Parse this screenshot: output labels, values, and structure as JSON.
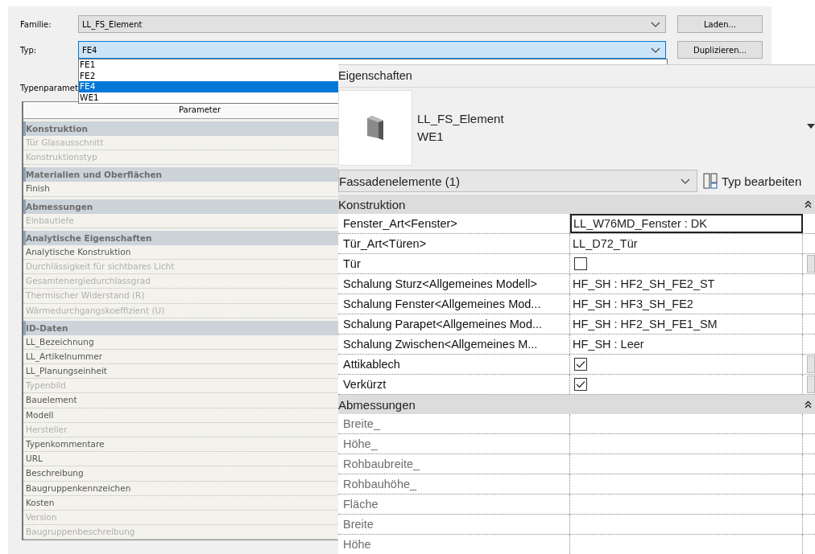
{
  "type_dialog": {
    "family": {
      "label": "Familie:",
      "value": "LL_FS_Element"
    },
    "type": {
      "label": "Typ:",
      "value": "FE4",
      "expanded": true,
      "options": [
        {
          "label": "FE1",
          "selected": false
        },
        {
          "label": "FE2",
          "selected": false
        },
        {
          "label": "FE4",
          "selected": true
        },
        {
          "label": "WE1",
          "selected": false
        }
      ]
    },
    "buttons": [
      "Laden...",
      "Duplizieren..."
    ],
    "type_parameters_label": "Typenparamet",
    "table": {
      "columns": [
        "Parameter"
      ],
      "rows": [
        {
          "kind": "group",
          "label": "Konstruktion"
        },
        {
          "kind": "param",
          "label": "Tür Glasausschnitt",
          "disabled": true
        },
        {
          "kind": "param",
          "label": "Konstruktionstyp",
          "disabled": true
        },
        {
          "kind": "group",
          "label": "Materialien und Oberflächen"
        },
        {
          "kind": "param",
          "label": "Finish",
          "disabled": false
        },
        {
          "kind": "group",
          "label": "Abmessungen"
        },
        {
          "kind": "param",
          "label": "Einbautiefe",
          "disabled": true
        },
        {
          "kind": "group",
          "label": "Analytische Eigenschaften"
        },
        {
          "kind": "param",
          "label": "Analytische Konstruktion",
          "disabled": false
        },
        {
          "kind": "param",
          "label": "Durchlässigkeit für sichtbares Licht",
          "disabled": true
        },
        {
          "kind": "param",
          "label": "Gesamtenergiedurchlassgrad",
          "disabled": true
        },
        {
          "kind": "param",
          "label": "Thermischer Widerstand (R)",
          "disabled": true
        },
        {
          "kind": "param",
          "label": "Wärmedurchgangskoeffizient (U)",
          "disabled": true
        },
        {
          "kind": "group",
          "label": "ID-Daten"
        },
        {
          "kind": "param",
          "label": "LL_Bezeichnung",
          "disabled": false
        },
        {
          "kind": "param",
          "label": "LL_Artikelnummer",
          "disabled": false
        },
        {
          "kind": "param",
          "label": "LL_Planungseinheit",
          "disabled": false
        },
        {
          "kind": "param",
          "label": "Typenbild",
          "disabled": true
        },
        {
          "kind": "param",
          "label": "Bauelement",
          "disabled": false
        },
        {
          "kind": "param",
          "label": "Modell",
          "disabled": false
        },
        {
          "kind": "param",
          "label": "Hersteller",
          "disabled": true
        },
        {
          "kind": "param",
          "label": "Typenkommentare",
          "disabled": false
        },
        {
          "kind": "param",
          "label": "URL",
          "disabled": false
        },
        {
          "kind": "param",
          "label": "Beschreibung",
          "disabled": false
        },
        {
          "kind": "param",
          "label": "Baugruppenkennzeichen",
          "disabled": false
        },
        {
          "kind": "param",
          "label": "Kosten",
          "disabled": false
        },
        {
          "kind": "param",
          "label": "Version",
          "disabled": true
        },
        {
          "kind": "param",
          "label": "Baugruppenbeschreibung",
          "disabled": true
        }
      ]
    }
  },
  "properties": {
    "title": "Eigenschaften",
    "family": "LL_FS_Element",
    "type": "WE1",
    "category": "Fassadenelemente (1)",
    "edit_type_button": "Typ bearbeiten",
    "groups": [
      {
        "name": "Konstruktion",
        "expanded": true,
        "rows": [
          {
            "kind": "text",
            "name": "Fenster_Art<Fenster>",
            "value": "LL_W76MD_Fenster : DK",
            "selected": true,
            "disabled": false
          },
          {
            "kind": "text",
            "name": "Tür_Art<Türen>",
            "value": "LL_D72_Tür",
            "selected": false,
            "disabled": false
          },
          {
            "kind": "checkbox",
            "name": "Tür",
            "checked": false,
            "selected": false,
            "disabled": false
          },
          {
            "kind": "text",
            "name": "Schalung Sturz<Allgemeines Modell>",
            "value": "HF_SH : HF2_SH_FE2_ST",
            "selected": false,
            "disabled": false
          },
          {
            "kind": "text",
            "name": "Schalung Fenster<Allgemeines Mod...",
            "value": "HF_SH : HF3_SH_FE2",
            "selected": false,
            "disabled": false
          },
          {
            "kind": "text",
            "name": "Schalung Parapet<Allgemeines Mod...",
            "value": "HF_SH : HF2_SH_FE1_SM",
            "selected": false,
            "disabled": false
          },
          {
            "kind": "text",
            "name": "Schalung Zwischen<Allgemeines M...",
            "value": "HF_SH : Leer",
            "selected": false,
            "disabled": false
          },
          {
            "kind": "checkbox",
            "name": "Attikablech",
            "checked": true,
            "selected": false,
            "disabled": false
          },
          {
            "kind": "checkbox",
            "name": "Verkürzt",
            "checked": true,
            "selected": false,
            "disabled": false
          }
        ]
      },
      {
        "name": "Abmessungen",
        "expanded": true,
        "rows": [
          {
            "kind": "empty",
            "name": "Breite_",
            "selected": false,
            "disabled": true
          },
          {
            "kind": "empty",
            "name": "Höhe_",
            "selected": false,
            "disabled": true
          },
          {
            "kind": "empty",
            "name": "Rohbaubreite_",
            "selected": false,
            "disabled": true
          },
          {
            "kind": "empty",
            "name": "Rohbauhöhe_",
            "selected": false,
            "disabled": true
          },
          {
            "kind": "empty",
            "name": "Fläche",
            "selected": false,
            "disabled": true
          },
          {
            "kind": "empty",
            "name": "Breite",
            "selected": false,
            "disabled": true
          },
          {
            "kind": "empty",
            "name": "Höhe",
            "selected": false,
            "disabled": true
          }
        ]
      }
    ]
  }
}
